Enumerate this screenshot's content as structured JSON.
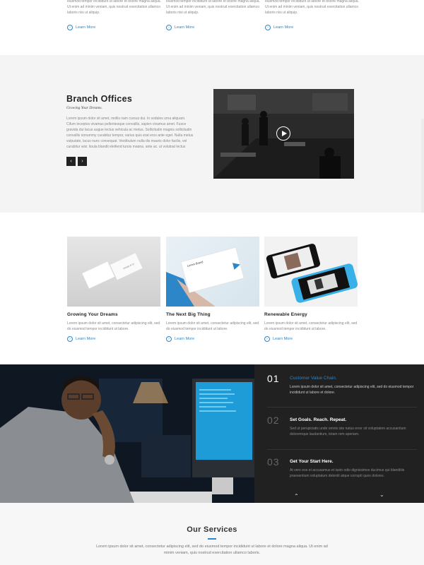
{
  "top_columns": [
    {
      "body": "eiusmod tempor incididunt ut labore et dolore magna aliqua. Ut enim ad minim veniam, quis nostrud exercitation ullamco laboris nisi ut aliquip.",
      "link": "Learn More"
    },
    {
      "body": "eiusmod tempor incididunt ut labore et dolore magna aliqua. Ut enim ad minim veniam, quis nostrud exercitation ullamco laboris nisi ut aliquip.",
      "link": "Learn More"
    },
    {
      "body": "eiusmod tempor incididunt ut labore et dolore magna aliqua. Ut enim ad minim veniam, quis nostrud exercitation ullamco laboris nisi ut aliquip.",
      "link": "Learn More"
    }
  ],
  "branch": {
    "title": "Branch Offices",
    "subtitle": "Growing Your Dreams.",
    "body": "Lorem ipsum dolor sit amet, mollis nam cursus dui. In sodales urna aliquam. Cifum inceptos vivamus pellentesque convallis, sapien vivamus amet. Fusce gravida dui lacus augue lectus vehicula ac metus. Sollicitudin magnis sollicitudin convallis nonummy curabitur tempor, varius quis erat eros ante eget. Nulla metus vulputate, lacus nunc consequat. Vestibulum nulla dis mauris dolor facilis, vel curabitur wisi, ligula blandit eleifend turpis magna, ante ac, ut volutpat lectus feugiat.",
    "prev": "‹",
    "next": "›"
  },
  "cards": [
    {
      "title": "Growing Your Dreams",
      "body": "Lorem ipsum dolor sit amet, consectetur adipiscing elit, sed do eiusmod tempor incididunt ut labore.",
      "link": "Learn More"
    },
    {
      "title": "The Next Big Thing",
      "body": "Lorem ipsum dolor sit amet, consectetur adipiscing elit, sed do eiusmod tempor incididunt ut labore.",
      "link": "Learn More"
    },
    {
      "title": "Renewable Energy",
      "body": "Lorem ipsum dolor sit amet, consectetur adipiscing elit, sed do eiusmod tempor incididunt ut labore.",
      "link": "Learn More"
    }
  ],
  "card_mock_text": {
    "card1": "Design & Co",
    "card2": "Lorem Brand"
  },
  "steps": [
    {
      "num": "01",
      "title": "Customer Value Chain.",
      "body": "Lorem ipsum dolor sit amet, consectetur adipiscing elit, sed do eiusmod tempor incididunt ut labore et dolore."
    },
    {
      "num": "02",
      "title": "Set Goals. Reach. Repeat.",
      "body": "Sed ut perspiciatis unde omnis iste natus error sit voluptatem accusantium doloremque laudantium, totam rem aperiam."
    },
    {
      "num": "03",
      "title": "Get Your Start Here.",
      "body": "At vero eos et accusamus et iusto odio dignissimos ducimus qui blanditiis praesentium voluptatum deleniti atque corrupti quos dolores."
    }
  ],
  "panel_nav": {
    "up": "⌃",
    "down": "⌄"
  },
  "services": {
    "title": "Our Services",
    "body": "Lorem ipsum dolor sit amet, consectetur adipiscing elit, sed do eiusmod tempor incididunt ut labore et dolore magna aliqua. Ut enim ad minim veniam, quis nostrud exercitation ullamco laboris."
  },
  "colors": {
    "accent": "#2d86c8",
    "dark_panel": "#212121",
    "section_gray": "#f4f4f4"
  }
}
